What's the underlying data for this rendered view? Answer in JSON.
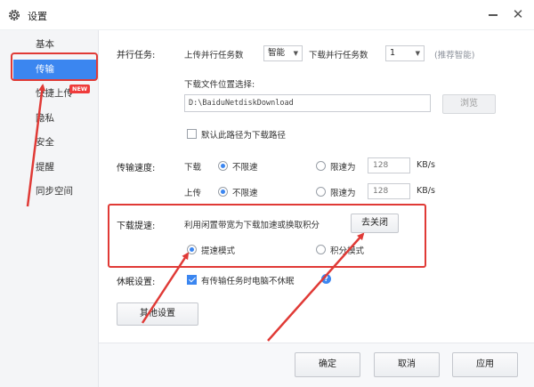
{
  "window": {
    "title": "设置"
  },
  "sidebar": {
    "items": [
      {
        "label": "基本"
      },
      {
        "label": "传输"
      },
      {
        "label": "快捷上传"
      },
      {
        "label": "隐私"
      },
      {
        "label": "安全"
      },
      {
        "label": "提醒"
      },
      {
        "label": "同步空间"
      }
    ],
    "active_index": 1,
    "new_badge": "NEW"
  },
  "parallel": {
    "label": "并行任务:",
    "upload_label": "上传并行任务数",
    "upload_value": "智能",
    "download_label": "下载并行任务数",
    "download_value": "1",
    "hint": "(推荐智能)"
  },
  "download_location": {
    "label": "下载文件位置选择:",
    "path": "D:\\BaiduNetdiskDownload",
    "browse_label": "浏览",
    "default_checkbox_label": "默认此路径为下载路径",
    "default_checked": false
  },
  "speed": {
    "label": "传输速度:",
    "download_label": "下载",
    "upload_label": "上传",
    "unlimited_label": "不限速",
    "limit_label": "限速为",
    "download_limit": "128",
    "upload_limit": "128",
    "unit": "KB/s"
  },
  "accelerate": {
    "label": "下载提速:",
    "description": "利用闲置带宽为下载加速或换取积分",
    "close_button": "去关闭",
    "mode_fast": "提速模式",
    "mode_points": "积分模式"
  },
  "sleep": {
    "label": "休眠设置:",
    "checkbox_label": "有传输任务时电脑不休眠",
    "checked": true
  },
  "other_settings_button": "其他设置",
  "footer": {
    "ok": "确定",
    "cancel": "取消",
    "apply": "应用"
  },
  "colors": {
    "accent": "#3b86f0",
    "annotation_red": "#e03a36",
    "badge_red": "#ef3b3b"
  }
}
